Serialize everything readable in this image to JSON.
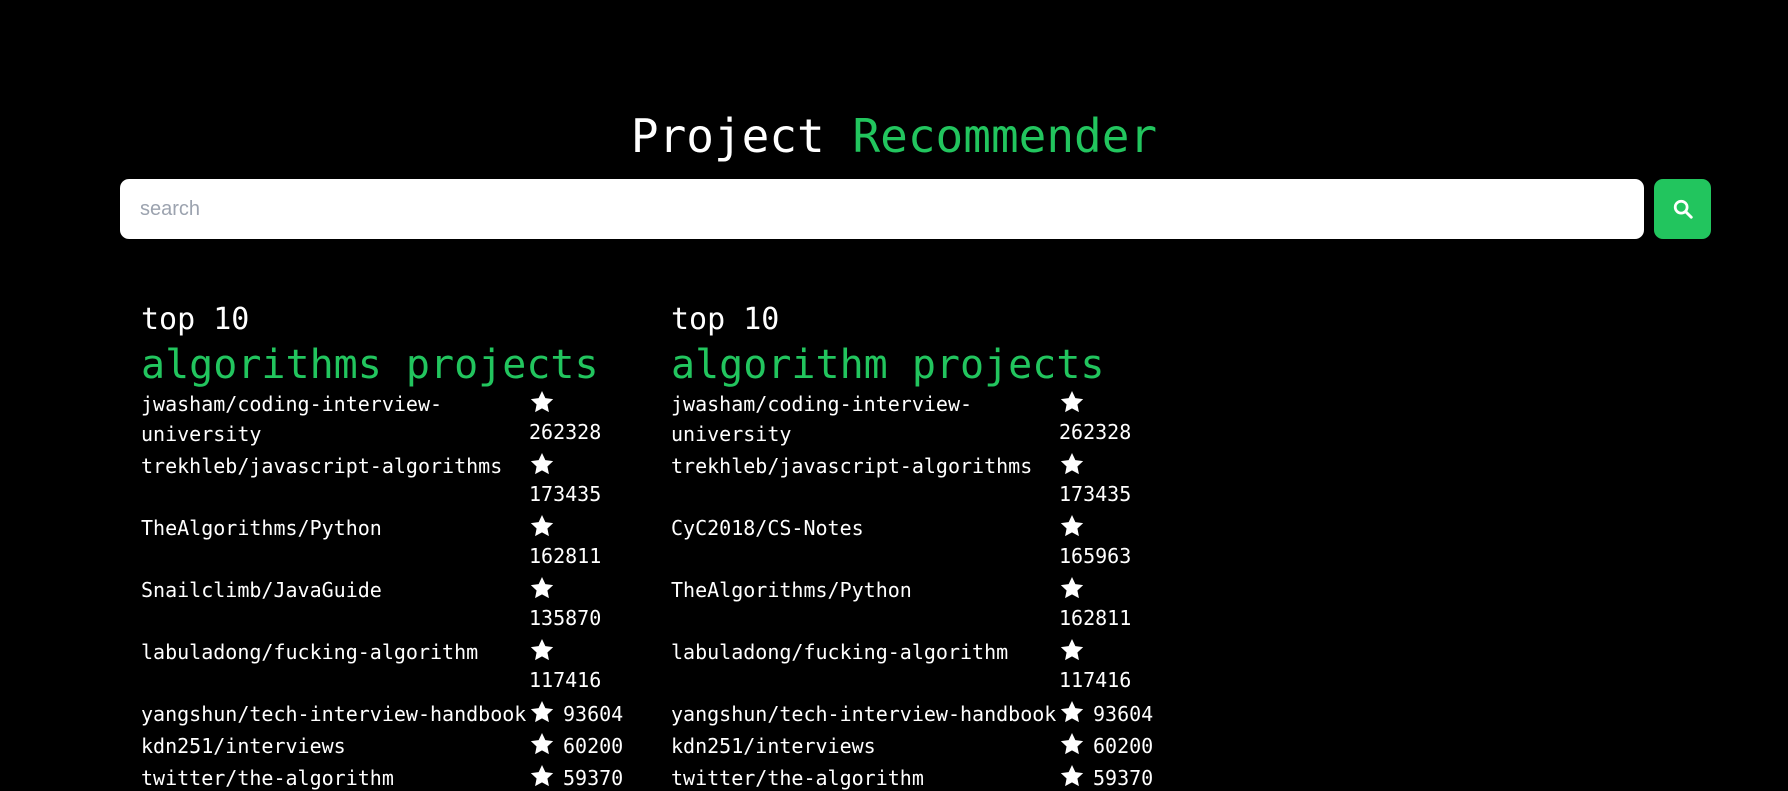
{
  "header": {
    "title_white": "Project",
    "title_green": "Recommender"
  },
  "search": {
    "placeholder": "search",
    "value": ""
  },
  "columns": [
    {
      "pre_title": "top 10",
      "title": "algorithms projects",
      "items": [
        {
          "repo": "jwasham/coding-interview-university",
          "stars": "262328"
        },
        {
          "repo": "trekhleb/javascript-algorithms",
          "stars": "173435"
        },
        {
          "repo": "TheAlgorithms/Python",
          "stars": "162811"
        },
        {
          "repo": "Snailclimb/JavaGuide",
          "stars": "135870"
        },
        {
          "repo": "labuladong/fucking-algorithm",
          "stars": "117416"
        },
        {
          "repo": "yangshun/tech-interview-handbook",
          "stars": "93604"
        },
        {
          "repo": "kdn251/interviews",
          "stars": "60200"
        },
        {
          "repo": "twitter/the-algorithm",
          "stars": "59370"
        }
      ]
    },
    {
      "pre_title": "top 10",
      "title": "algorithm projects",
      "items": [
        {
          "repo": "jwasham/coding-interview-university",
          "stars": "262328"
        },
        {
          "repo": "trekhleb/javascript-algorithms",
          "stars": "173435"
        },
        {
          "repo": "CyC2018/CS-Notes",
          "stars": "165963"
        },
        {
          "repo": "TheAlgorithms/Python",
          "stars": "162811"
        },
        {
          "repo": "labuladong/fucking-algorithm",
          "stars": "117416"
        },
        {
          "repo": "yangshun/tech-interview-handbook",
          "stars": "93604"
        },
        {
          "repo": "kdn251/interviews",
          "stars": "60200"
        },
        {
          "repo": "twitter/the-algorithm",
          "stars": "59370"
        }
      ]
    }
  ],
  "icons": {
    "search": "search-icon",
    "star": "star-icon"
  },
  "colors": {
    "background": "#000000",
    "accent": "#22c55e",
    "text": "#ffffff"
  }
}
